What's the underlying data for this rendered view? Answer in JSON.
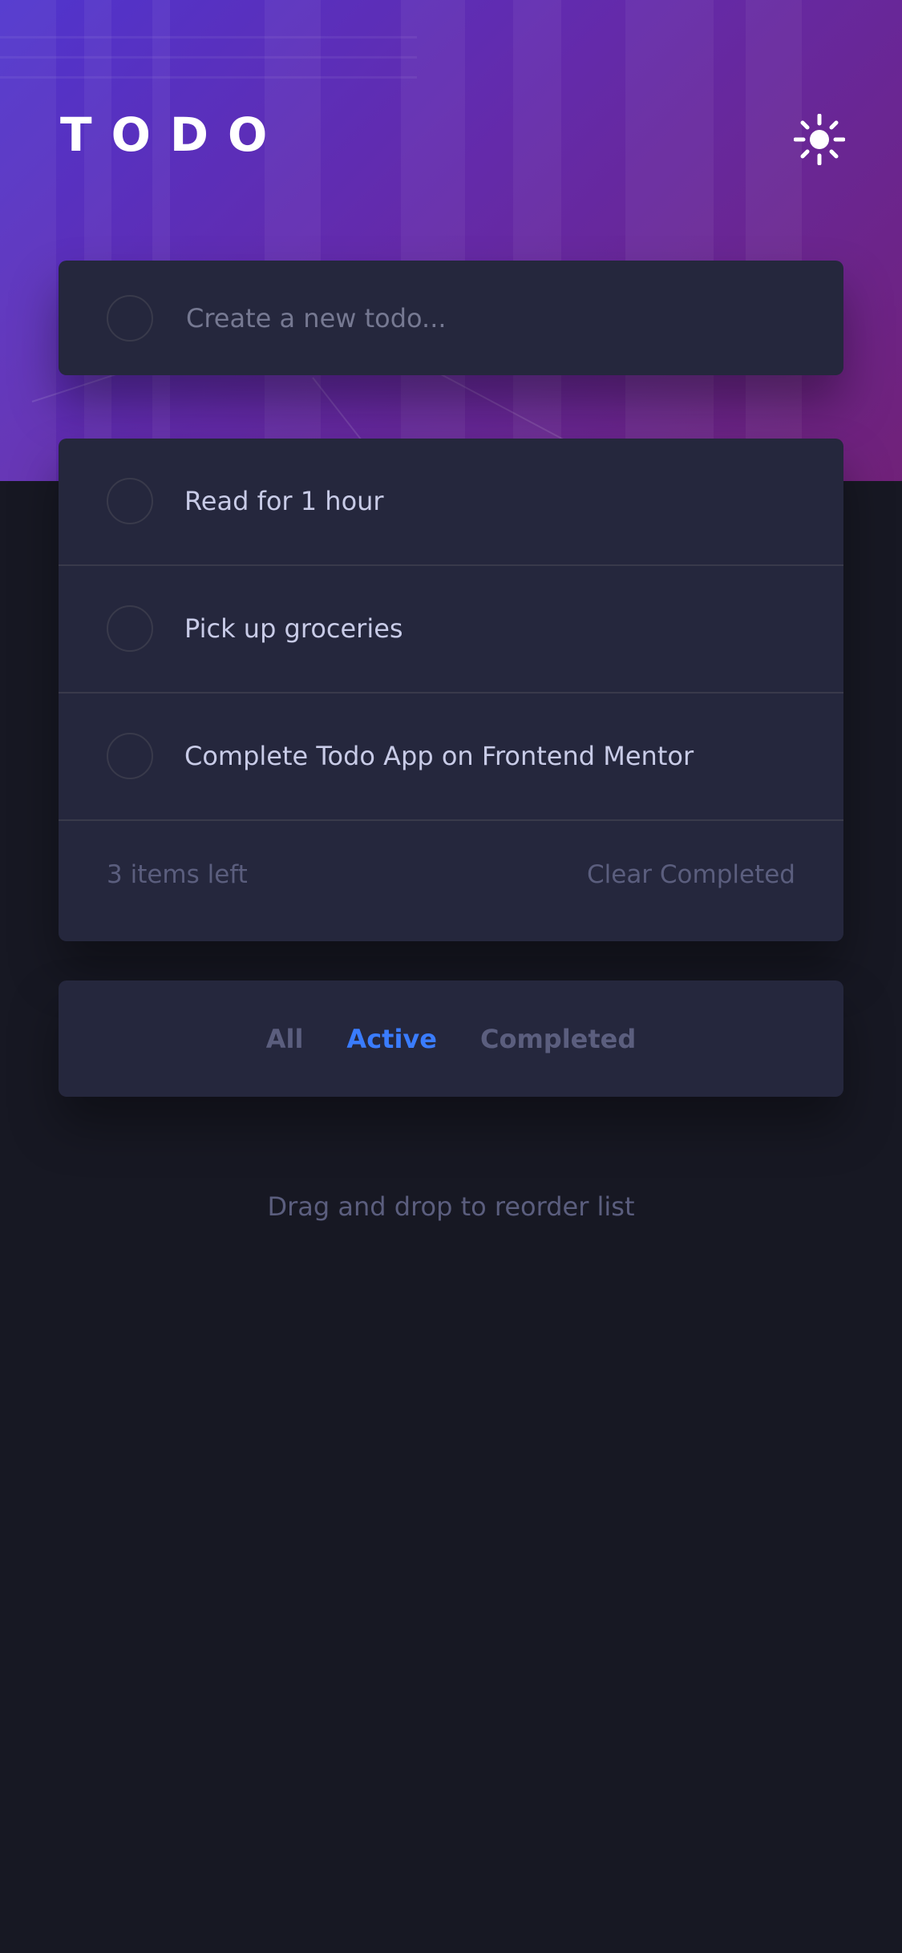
{
  "app": {
    "title": "TODO"
  },
  "theme_toggle": {
    "icon": "sun-icon"
  },
  "new_todo": {
    "placeholder": "Create a new todo..."
  },
  "todos": [
    {
      "text": "Read for 1 hour"
    },
    {
      "text": "Pick up groceries"
    },
    {
      "text": "Complete Todo App on Frontend Mentor"
    }
  ],
  "footer": {
    "items_left": "3 items left",
    "clear_label": "Clear Completed"
  },
  "filters": {
    "all": "All",
    "active": "Active",
    "completed": "Completed",
    "selected": "Active"
  },
  "hint": "Drag and drop to reorder list",
  "colors": {
    "background": "#171823",
    "card": "#25273D",
    "accent": "#3A7CFD",
    "muted": "#5B5E7E",
    "text": "#C8CBE7",
    "divider": "#393A4B"
  }
}
